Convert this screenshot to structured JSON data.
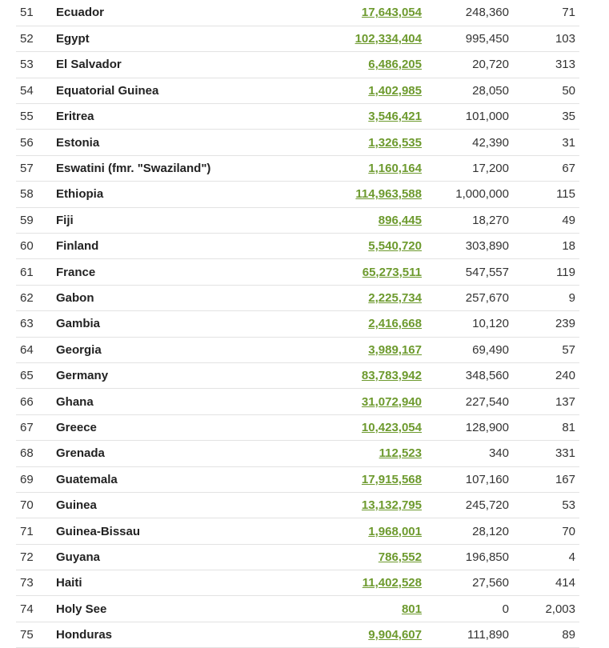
{
  "table": {
    "rows": [
      {
        "rank": "51",
        "country": "Ecuador",
        "population": "17,643,054",
        "land_area": "248,360",
        "density": "71"
      },
      {
        "rank": "52",
        "country": "Egypt",
        "population": "102,334,404",
        "land_area": "995,450",
        "density": "103"
      },
      {
        "rank": "53",
        "country": "El Salvador",
        "population": "6,486,205",
        "land_area": "20,720",
        "density": "313"
      },
      {
        "rank": "54",
        "country": "Equatorial Guinea",
        "population": "1,402,985",
        "land_area": "28,050",
        "density": "50"
      },
      {
        "rank": "55",
        "country": "Eritrea",
        "population": "3,546,421",
        "land_area": "101,000",
        "density": "35"
      },
      {
        "rank": "56",
        "country": "Estonia",
        "population": "1,326,535",
        "land_area": "42,390",
        "density": "31"
      },
      {
        "rank": "57",
        "country": "Eswatini (fmr. \"Swaziland\")",
        "population": "1,160,164",
        "land_area": "17,200",
        "density": "67"
      },
      {
        "rank": "58",
        "country": "Ethiopia",
        "population": "114,963,588",
        "land_area": "1,000,000",
        "density": "115"
      },
      {
        "rank": "59",
        "country": "Fiji",
        "population": "896,445",
        "land_area": "18,270",
        "density": "49"
      },
      {
        "rank": "60",
        "country": "Finland",
        "population": "5,540,720",
        "land_area": "303,890",
        "density": "18"
      },
      {
        "rank": "61",
        "country": "France",
        "population": "65,273,511",
        "land_area": "547,557",
        "density": "119"
      },
      {
        "rank": "62",
        "country": "Gabon",
        "population": "2,225,734",
        "land_area": "257,670",
        "density": "9"
      },
      {
        "rank": "63",
        "country": "Gambia",
        "population": "2,416,668",
        "land_area": "10,120",
        "density": "239"
      },
      {
        "rank": "64",
        "country": "Georgia",
        "population": "3,989,167",
        "land_area": "69,490",
        "density": "57"
      },
      {
        "rank": "65",
        "country": "Germany",
        "population": "83,783,942",
        "land_area": "348,560",
        "density": "240"
      },
      {
        "rank": "66",
        "country": "Ghana",
        "population": "31,072,940",
        "land_area": "227,540",
        "density": "137"
      },
      {
        "rank": "67",
        "country": "Greece",
        "population": "10,423,054",
        "land_area": "128,900",
        "density": "81"
      },
      {
        "rank": "68",
        "country": "Grenada",
        "population": "112,523",
        "land_area": "340",
        "density": "331"
      },
      {
        "rank": "69",
        "country": "Guatemala",
        "population": "17,915,568",
        "land_area": "107,160",
        "density": "167"
      },
      {
        "rank": "70",
        "country": "Guinea",
        "population": "13,132,795",
        "land_area": "245,720",
        "density": "53"
      },
      {
        "rank": "71",
        "country": "Guinea-Bissau",
        "population": "1,968,001",
        "land_area": "28,120",
        "density": "70"
      },
      {
        "rank": "72",
        "country": "Guyana",
        "population": "786,552",
        "land_area": "196,850",
        "density": "4"
      },
      {
        "rank": "73",
        "country": "Haiti",
        "population": "11,402,528",
        "land_area": "27,560",
        "density": "414"
      },
      {
        "rank": "74",
        "country": "Holy See",
        "population": "801",
        "land_area": "0",
        "density": "2,003"
      },
      {
        "rank": "75",
        "country": "Honduras",
        "population": "9,904,607",
        "land_area": "111,890",
        "density": "89"
      }
    ]
  },
  "colors": {
    "link_green": "#6d9a2e",
    "divider": "#e3e3e3",
    "text": "#222222"
  }
}
